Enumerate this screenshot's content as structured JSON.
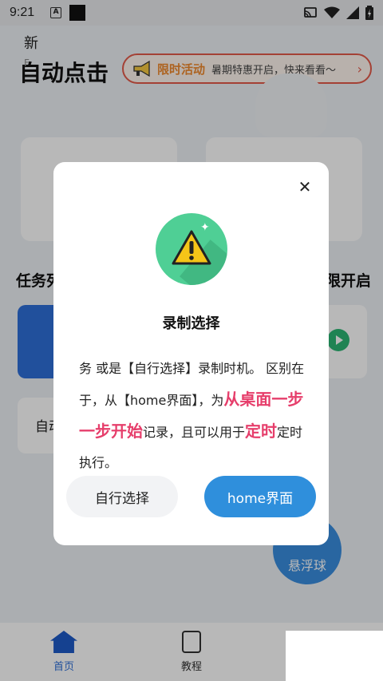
{
  "status_bar": {
    "time": "9:21",
    "a_icon_label": "A"
  },
  "header": {
    "title": "自动点击",
    "promo_label": "限时活动",
    "promo_text": "暑期特惠开启，快来看看～",
    "promo_arrow": "›"
  },
  "cards": {
    "card1_title_partial": "新",
    "card1_sub_partial": "F"
  },
  "sections": {
    "left_title_partial": "任务列",
    "right_title_partial": "限开启"
  },
  "list": {
    "auto_text_partial": "自动"
  },
  "float_ball": {
    "label": "悬浮球"
  },
  "nav": {
    "home": "首页",
    "tutorial": "教程"
  },
  "modal": {
    "close": "✕",
    "title": "录制选择",
    "body_1": "务 或是【自行选择】录制时机。 区别在于，从【home界面】，为",
    "body_hl1": "从桌面一步一步开始",
    "body_2": "记录，且可以用于",
    "body_hl2": "定时",
    "body_3": "定时执行。",
    "btn_custom": "自行选择",
    "btn_home": "home界面"
  },
  "colors": {
    "accent": "#2f8fdc",
    "highlight": "#e63e6b",
    "warn_green": "#4fcf95",
    "warn_yellow": "#f5c518"
  }
}
